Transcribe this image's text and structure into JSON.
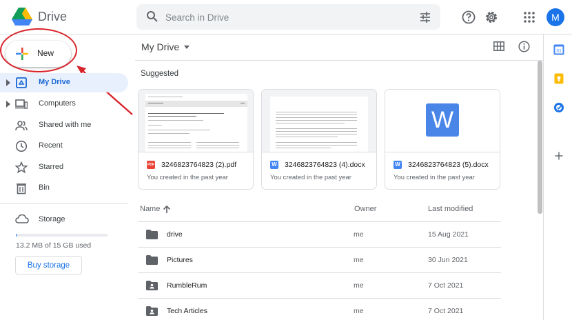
{
  "app": {
    "title": "Drive"
  },
  "search": {
    "placeholder": "Search in Drive"
  },
  "header_icons": [
    "help-icon",
    "settings-icon",
    "apps-grid-icon"
  ],
  "account": {
    "initial": "M",
    "color": "#1a73e8"
  },
  "new_button": {
    "label": "New"
  },
  "sidebar": {
    "items": [
      {
        "label": "My Drive",
        "icon": "my-drive-icon",
        "active": true
      },
      {
        "label": "Computers",
        "icon": "computers-icon"
      },
      {
        "label": "Shared with me",
        "icon": "shared-with-me-icon"
      },
      {
        "label": "Recent",
        "icon": "clock-icon"
      },
      {
        "label": "Starred",
        "icon": "star-icon"
      },
      {
        "label": "Bin",
        "icon": "trash-icon"
      }
    ],
    "storage": {
      "label": "Storage",
      "used_text": "13.2 MB of 15 GB used",
      "used_fraction": 0.0009,
      "buy_label": "Buy storage"
    }
  },
  "main": {
    "breadcrumb": "My Drive",
    "suggested_label": "Suggested",
    "suggested": [
      {
        "name": "3246823764823 (2).pdf",
        "type": "PDF",
        "type_color": "#ea4335",
        "subtitle": "You created in the past year"
      },
      {
        "name": "3246823764823 (4).docx",
        "type": "W",
        "type_color": "#4285f4",
        "subtitle": "You created in the past year"
      },
      {
        "name": "3246823764823 (5).docx",
        "type": "W",
        "type_color": "#4285f4",
        "subtitle": "You created in the past year"
      }
    ],
    "columns": {
      "name": "Name",
      "owner": "Owner",
      "modified": "Last modified"
    },
    "files": [
      {
        "name": "drive",
        "owner": "me",
        "modified": "15 Aug 2021",
        "icon": "folder-icon"
      },
      {
        "name": "Pictures",
        "owner": "me",
        "modified": "30 Jun 2021",
        "icon": "folder-icon"
      },
      {
        "name": "RumbleRum",
        "owner": "me",
        "modified": "7 Oct 2021",
        "icon": "shared-folder-icon"
      },
      {
        "name": "Tech Articles",
        "owner": "me",
        "modified": "7 Oct 2021",
        "icon": "shared-folder-icon"
      }
    ]
  },
  "side_panel": [
    "calendar-icon",
    "keep-icon",
    "tasks-icon",
    "add-icon"
  ],
  "colors": {
    "accent": "#1a73e8",
    "active_bg": "#e8f0fe",
    "annotation": "#d9232b"
  }
}
